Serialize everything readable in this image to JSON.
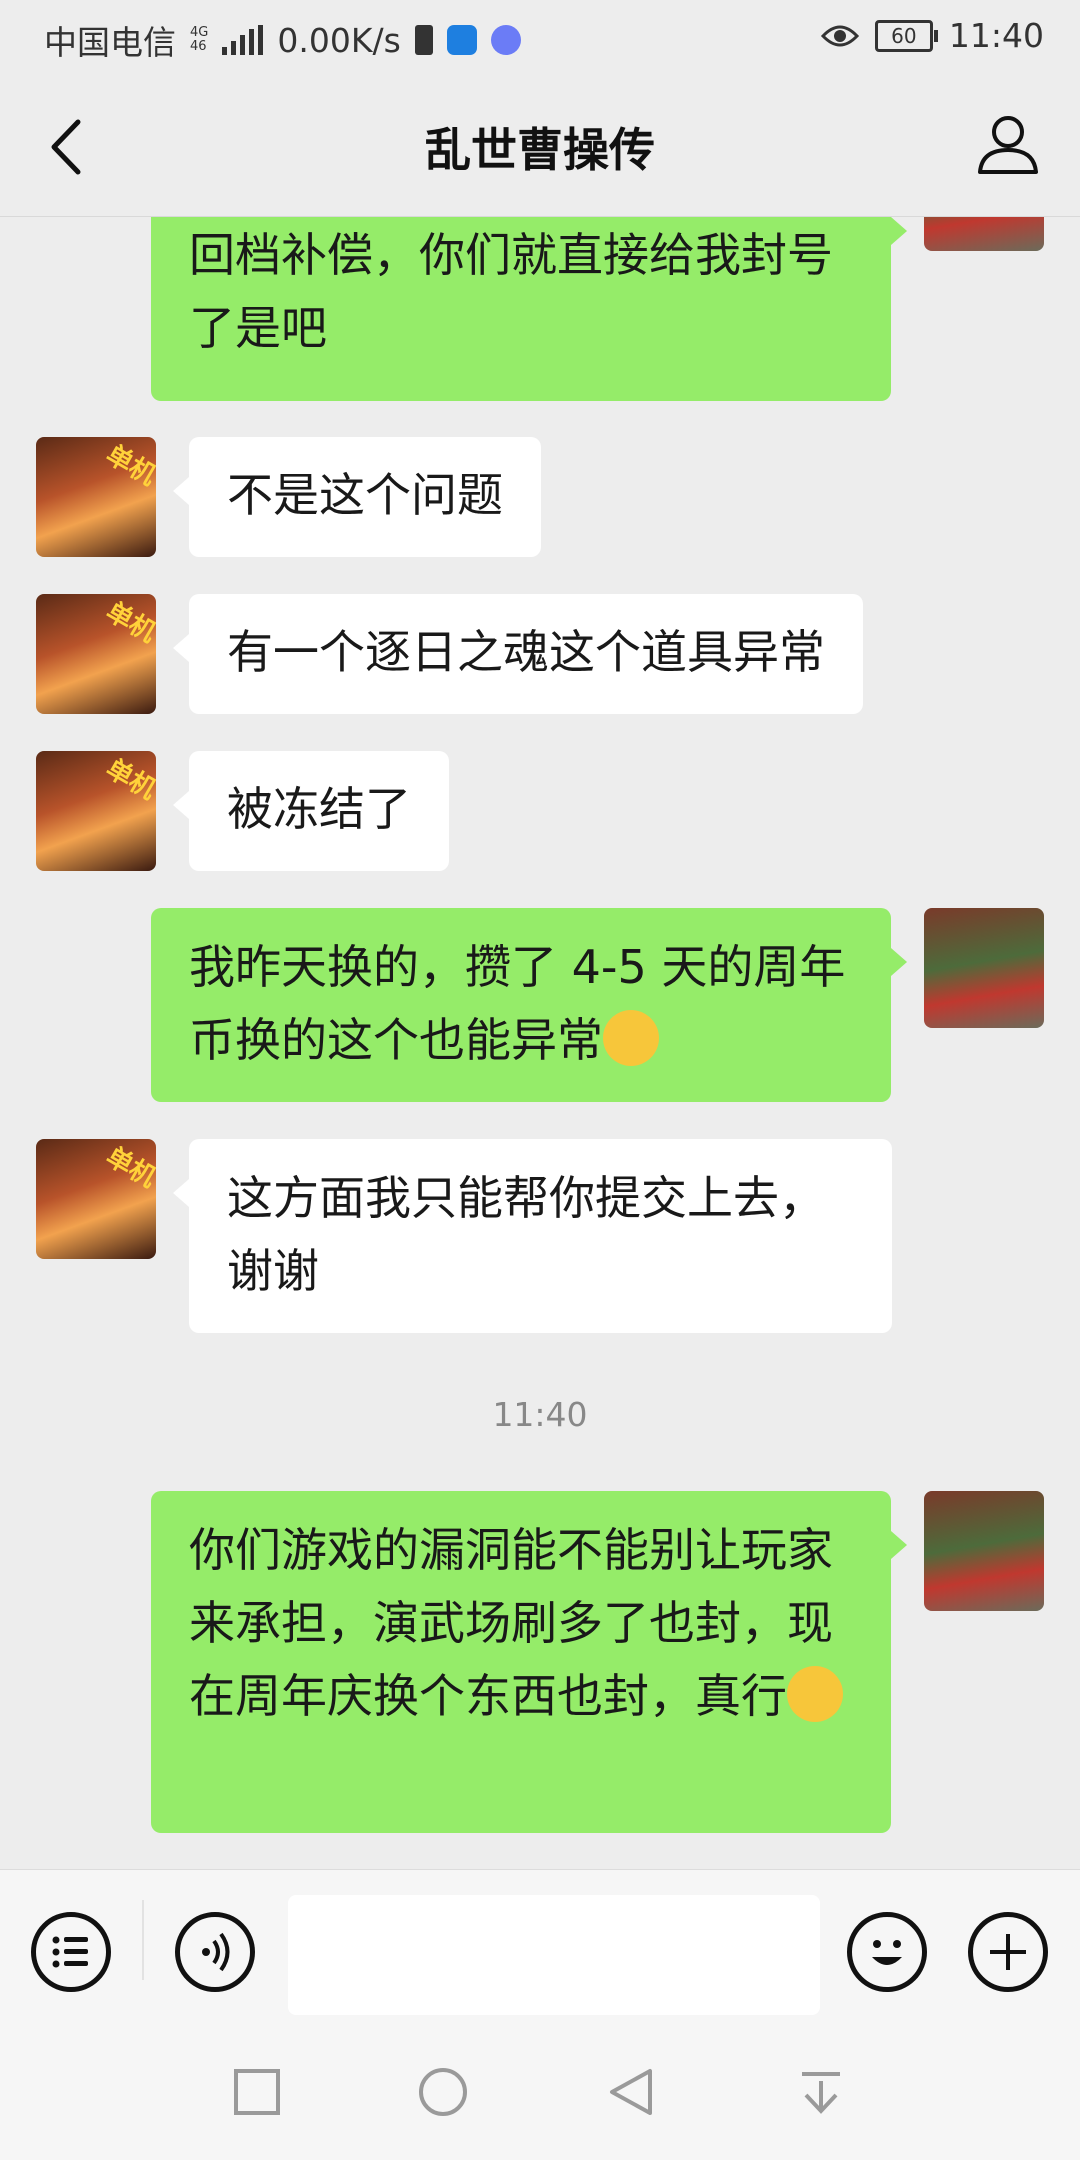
{
  "status_bar": {
    "carrier": "中国电信",
    "network_gen_top": "4G",
    "network_gen_bottom": "46",
    "speed": "0.00K/s",
    "battery": "60",
    "time": "11:40"
  },
  "header": {
    "title": "乱世曹操传"
  },
  "messages": [
    {
      "from": "me",
      "text": "回档补偿，你们就直接给我封号了是吧"
    },
    {
      "from": "cs",
      "text": "不是这个问题"
    },
    {
      "from": "cs",
      "text": "有一个逐日之魂这个道具异常"
    },
    {
      "from": "cs",
      "text": "被冻结了"
    },
    {
      "from": "me",
      "text": "我昨天换的，攒了 4-5 天的周年币换的这个也能异常"
    },
    {
      "from": "cs",
      "text": "这方面我只能帮你提交上去，谢谢"
    },
    {
      "from": "me",
      "text": "你们游戏的漏洞能不能别让玩家来承担，演武场刷多了也封，现在周年庆换个东西也封，真行"
    }
  ],
  "timestamp": "11:40",
  "icons": {
    "back": "chevron-left-icon",
    "profile": "person-icon",
    "menu": "list-menu-icon",
    "voice": "voice-icon",
    "emoji": "smiley-icon",
    "plus": "plus-icon",
    "nav_square": "recent-apps-icon",
    "nav_circle": "home-icon",
    "nav_triangle": "back-triangle-icon",
    "nav_down": "notification-pull-icon"
  },
  "colors": {
    "background": "#ededed",
    "bubble_out": "#95ec69",
    "bubble_in": "#ffffff"
  }
}
